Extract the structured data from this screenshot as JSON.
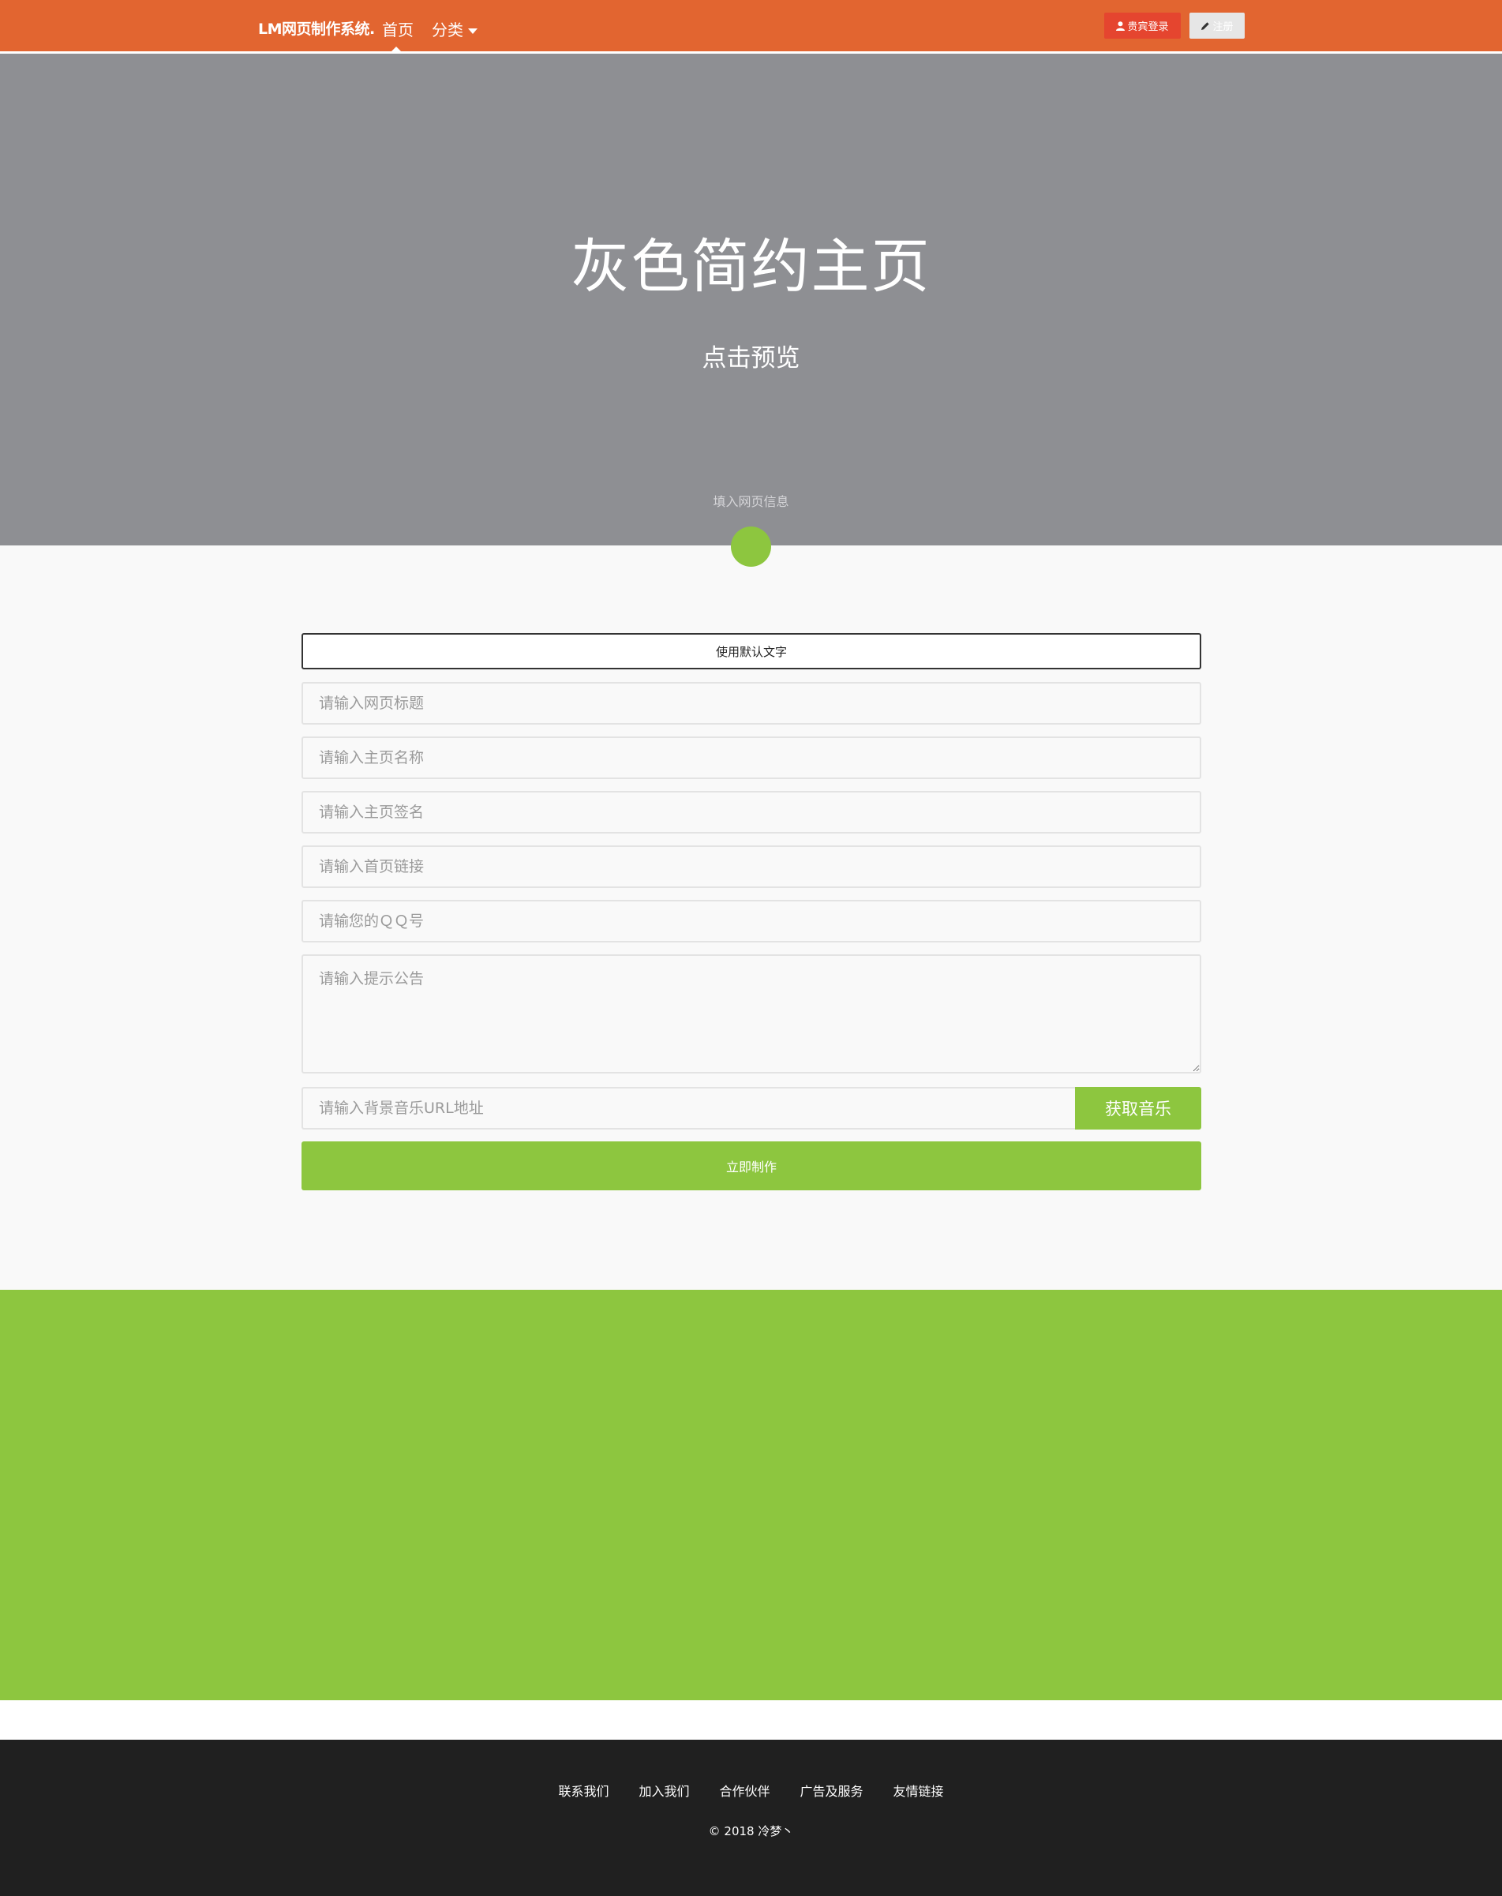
{
  "navbar": {
    "brand": "LM网页制作系统.",
    "home": "首页",
    "category": "分类",
    "login_icon": "user-icon",
    "login": "贵宾登录",
    "register_icon": "pencil-icon",
    "register": "注册"
  },
  "hero": {
    "title": "灰色简约主页",
    "subtitle": "点击预览",
    "hint": "填入网页信息"
  },
  "form": {
    "default_text_button": "使用默认文字",
    "title_placeholder": "请输入网页标题",
    "name_placeholder": "请输入主页名称",
    "signature_placeholder": "请输入主页签名",
    "link_placeholder": "请输入首页链接",
    "qq_placeholder": "请输您的ＱＱ号",
    "notice_placeholder": "请输入提示公告",
    "music_placeholder": "请输入背景音乐URL地址",
    "music_button": "获取音乐",
    "submit_button": "立即制作"
  },
  "footer": {
    "links": [
      "联系我们",
      "加入我们",
      "合作伙伴",
      "广告及服务",
      "友情链接"
    ],
    "copyright": "© 2018 冷梦丶"
  },
  "colors": {
    "navbar": "#e26530",
    "hero": "#8e8f93",
    "accent_green": "#8dc63f",
    "login_red": "#e5452f",
    "footer": "#202020"
  }
}
